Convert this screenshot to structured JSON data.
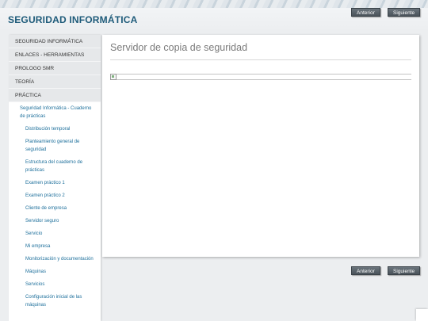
{
  "header": {
    "site_title": "SEGURIDAD INFORMÁTICA",
    "prev_label": "Anterior",
    "next_label": "Siguiente"
  },
  "sidebar": {
    "top_items": [
      {
        "label": "SEGURIDAD INFORMÁTICA"
      },
      {
        "label": "ENLACES - HERRAMIENTAS"
      },
      {
        "label": "PROLOGO SMR"
      },
      {
        "label": "TEORÍA"
      },
      {
        "label": "PRÁCTICA"
      }
    ],
    "sub_parent": {
      "label": "Seguridad Informática - Cuaderno de prácticas"
    },
    "sub_items": [
      {
        "label": "Distribución temporal"
      },
      {
        "label": "Planteamiento general de seguridad"
      },
      {
        "label": "Estructura del cuaderno de prácticas"
      },
      {
        "label": "Examen práctico 1"
      },
      {
        "label": "Examen práctico 2"
      },
      {
        "label": "Cliente de empresa"
      },
      {
        "label": "Servidor seguro"
      },
      {
        "label": "Servicio"
      },
      {
        "label": "Mi empresa"
      },
      {
        "label": "Monitorización y documentación"
      },
      {
        "label": "Máquinas"
      },
      {
        "label": "Servicios"
      },
      {
        "label": "Configuración inicial de las máquinas"
      }
    ]
  },
  "main": {
    "page_title": "Servidor de copia de seguridad"
  },
  "footer": {
    "prev_label": "Anterior",
    "next_label": "Siguiente"
  }
}
